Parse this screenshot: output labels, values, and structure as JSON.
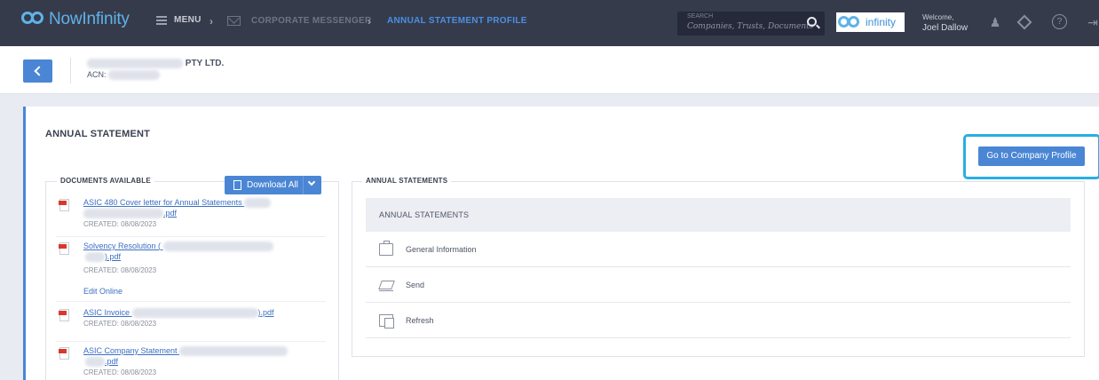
{
  "nav": {
    "brand": "NowInfinity",
    "menu_label": "MENU",
    "breadcrumb": [
      "CORPORATE MESSENGER",
      "ANNUAL STATEMENT PROFILE"
    ],
    "search": {
      "label": "SEARCH",
      "placeholder": "Companies, Trusts, Documents"
    },
    "partner_logo_text": "infinity",
    "welcome_label": "Welcome,",
    "user_name": "Joel Dallow",
    "icons": [
      "user-manage-icon",
      "diamond-icon",
      "help-icon",
      "logout-icon"
    ]
  },
  "header": {
    "company_name_suffix": "PTY LTD.",
    "acn_label": "ACN:"
  },
  "page": {
    "title": "ANNUAL STATEMENT",
    "go_to_profile_label": "Go to Company Profile"
  },
  "documents": {
    "legend": "DOCUMENTS AVAILABLE",
    "download_all_label": "Download All",
    "items": [
      {
        "name_start": "ASIC 480 Cover letter for Annual Statements",
        "name_end": ".pdf",
        "created": "CREATED: 08/08/2023"
      },
      {
        "name_start": "Solvency Resolution (",
        "name_end": ").pdf",
        "created": "CREATED: 08/08/2023",
        "edit_online": "Edit Online"
      },
      {
        "name_start": "ASIC Invoice",
        "name_end": ").pdf",
        "created": "CREATED: 08/08/2023"
      },
      {
        "name_start": "ASIC Company Statement",
        "name_end": ".pdf",
        "created": "CREATED: 08/08/2023"
      }
    ]
  },
  "statements": {
    "legend": "ANNUAL STATEMENTS",
    "header": "ANNUAL STATEMENTS",
    "rows": [
      {
        "label": "General Information",
        "icon": "briefcase-icon"
      },
      {
        "label": "Send",
        "icon": "send-mail-icon"
      },
      {
        "label": "Refresh",
        "icon": "refresh-document-icon"
      }
    ]
  },
  "colors": {
    "nav_bg": "#363b4c",
    "accent": "#4a86d4",
    "active_crumb": "#4a90e2",
    "highlight": "#29aee3"
  }
}
